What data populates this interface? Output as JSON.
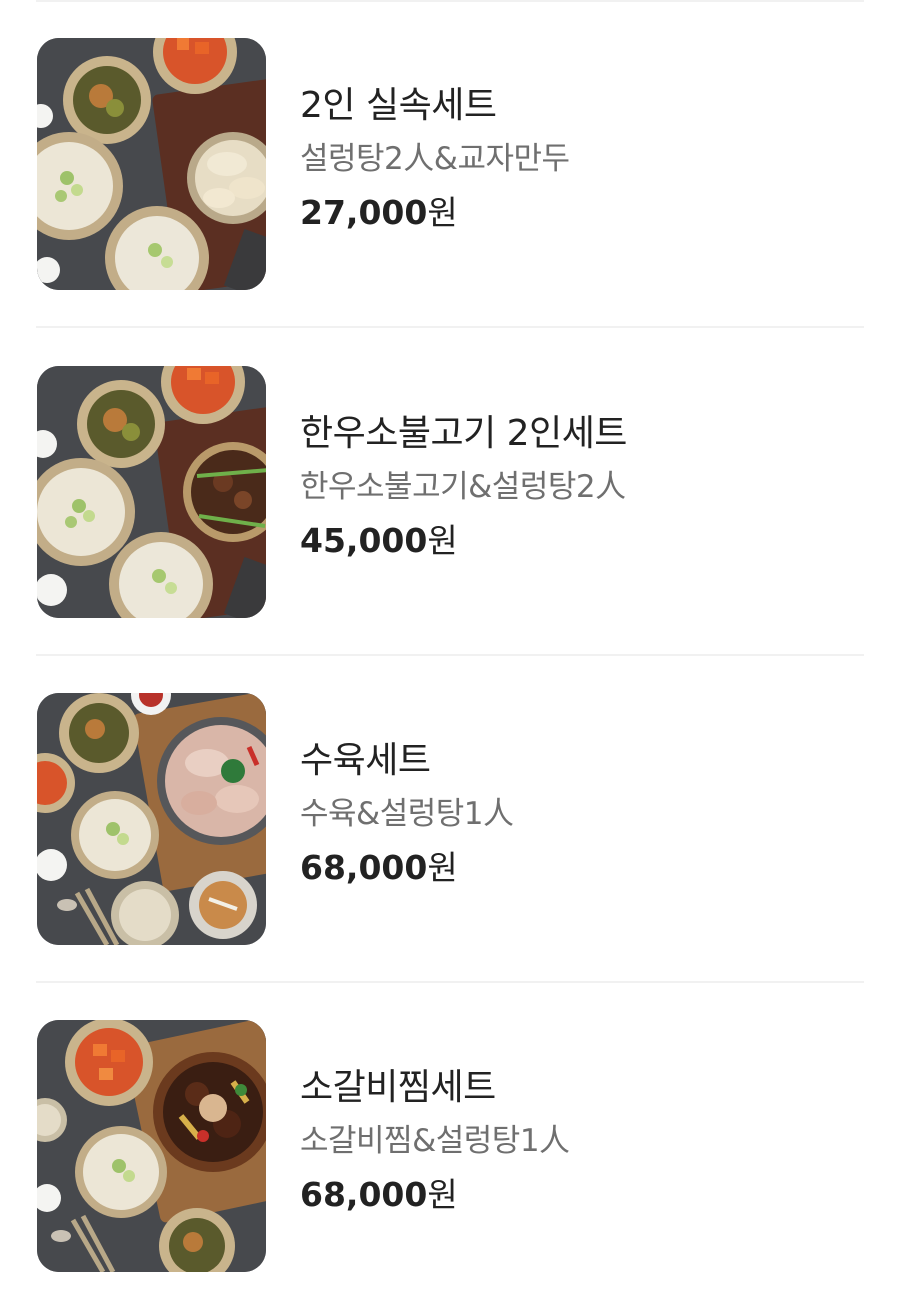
{
  "menu_items": [
    {
      "name": "2인 실속세트",
      "description": "설렁탕2人&교자만두",
      "price": "27,000",
      "currency": "원",
      "image": "food-photo-seolleongtang-dumplings"
    },
    {
      "name": "한우소불고기 2인세트",
      "description": "한우소불고기&설렁탕2人",
      "price": "45,000",
      "currency": "원",
      "image": "food-photo-bulgogi-seolleongtang"
    },
    {
      "name": "수육세트",
      "description": "수육&설렁탕1人",
      "price": "68,000",
      "currency": "원",
      "image": "food-photo-suyuk-seolleongtang"
    },
    {
      "name": "소갈비찜세트",
      "description": "소갈비찜&설렁탕1人",
      "price": "68,000",
      "currency": "원",
      "image": "food-photo-galbijjim-seolleongtang"
    }
  ]
}
